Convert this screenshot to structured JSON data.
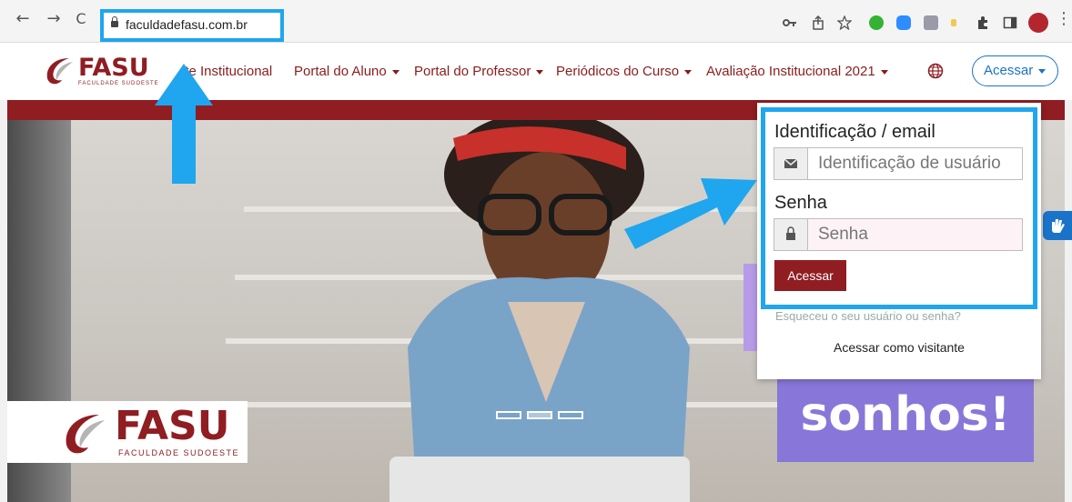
{
  "browser": {
    "url": "faculdadefasu.com.br",
    "back_icon": "arrow-left-icon",
    "forward_icon": "arrow-right-icon",
    "reload_icon": "reload-icon",
    "glyphs": {
      "back": "←",
      "forward": "→",
      "reload": "C",
      "menu": "⋮"
    }
  },
  "header": {
    "logo_text": "FASU",
    "logo_subtext": "FACULDADE SUDOESTE",
    "nav": [
      {
        "label": "Site Institucional",
        "visible": "ite Institucional",
        "dropdown": false
      },
      {
        "label": "Portal do Aluno",
        "dropdown": true
      },
      {
        "label": "Portal do Professor",
        "dropdown": true
      },
      {
        "label": "Periódicos do Curso",
        "dropdown": true
      },
      {
        "label": "Avaliação Institucional 2021",
        "dropdown": true
      }
    ],
    "language_icon": "globe-icon",
    "login_button": "Acessar"
  },
  "login_form": {
    "username_label": "Identificação / email",
    "username_placeholder": "Identificação de usuário",
    "password_label": "Senha",
    "password_placeholder": "Senha",
    "submit_label": "Acessar",
    "forgot_link": "Esqueceu o seu usuário ou senha?",
    "guest_link": "Acessar como visitante"
  },
  "hero": {
    "logo_text": "FASU",
    "logo_subtext": "FACULDADE SUDOESTE",
    "banner_text": "sonhos!"
  },
  "colors": {
    "brand_red": "#8f1d22",
    "link_blue": "#1a73c8",
    "highlight_blue": "#1fa6ee",
    "banner_purple": "#8877d8"
  }
}
